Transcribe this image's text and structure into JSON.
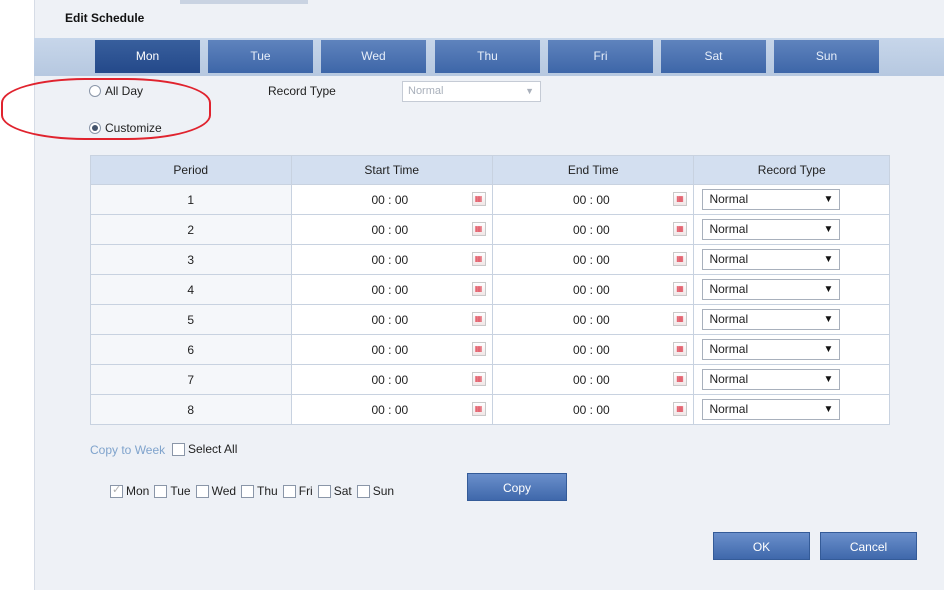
{
  "dialog": {
    "title": "Edit Schedule"
  },
  "days": [
    "Mon",
    "Tue",
    "Wed",
    "Thu",
    "Fri",
    "Sat",
    "Sun"
  ],
  "active_day": "Mon",
  "mode": {
    "all_day_label": "All Day",
    "customize_label": "Customize",
    "selected": "Customize"
  },
  "record_type": {
    "label": "Record Type",
    "value": "Normal",
    "disabled": true
  },
  "table": {
    "headers": [
      "Period",
      "Start Time",
      "End Time",
      "Record Type"
    ],
    "rows": [
      {
        "period": "1",
        "start": "00 : 00",
        "end": "00 : 00",
        "type": "Normal"
      },
      {
        "period": "2",
        "start": "00 : 00",
        "end": "00 : 00",
        "type": "Normal"
      },
      {
        "period": "3",
        "start": "00 : 00",
        "end": "00 : 00",
        "type": "Normal"
      },
      {
        "period": "4",
        "start": "00 : 00",
        "end": "00 : 00",
        "type": "Normal"
      },
      {
        "period": "5",
        "start": "00 : 00",
        "end": "00 : 00",
        "type": "Normal"
      },
      {
        "period": "6",
        "start": "00 : 00",
        "end": "00 : 00",
        "type": "Normal"
      },
      {
        "period": "7",
        "start": "00 : 00",
        "end": "00 : 00",
        "type": "Normal"
      },
      {
        "period": "8",
        "start": "00 : 00",
        "end": "00 : 00",
        "type": "Normal"
      }
    ]
  },
  "copy": {
    "copy_to_week_label": "Copy to Week",
    "select_all_label": "Select All",
    "days": [
      {
        "label": "Mon",
        "checked": true
      },
      {
        "label": "Tue",
        "checked": false
      },
      {
        "label": "Wed",
        "checked": false
      },
      {
        "label": "Thu",
        "checked": false
      },
      {
        "label": "Fri",
        "checked": false
      },
      {
        "label": "Sat",
        "checked": false
      },
      {
        "label": "Sun",
        "checked": false
      }
    ],
    "copy_button": "Copy"
  },
  "actions": {
    "ok": "OK",
    "cancel": "Cancel"
  },
  "colors": {
    "accent": "#3f68ab",
    "annotation": "#e0232e"
  }
}
